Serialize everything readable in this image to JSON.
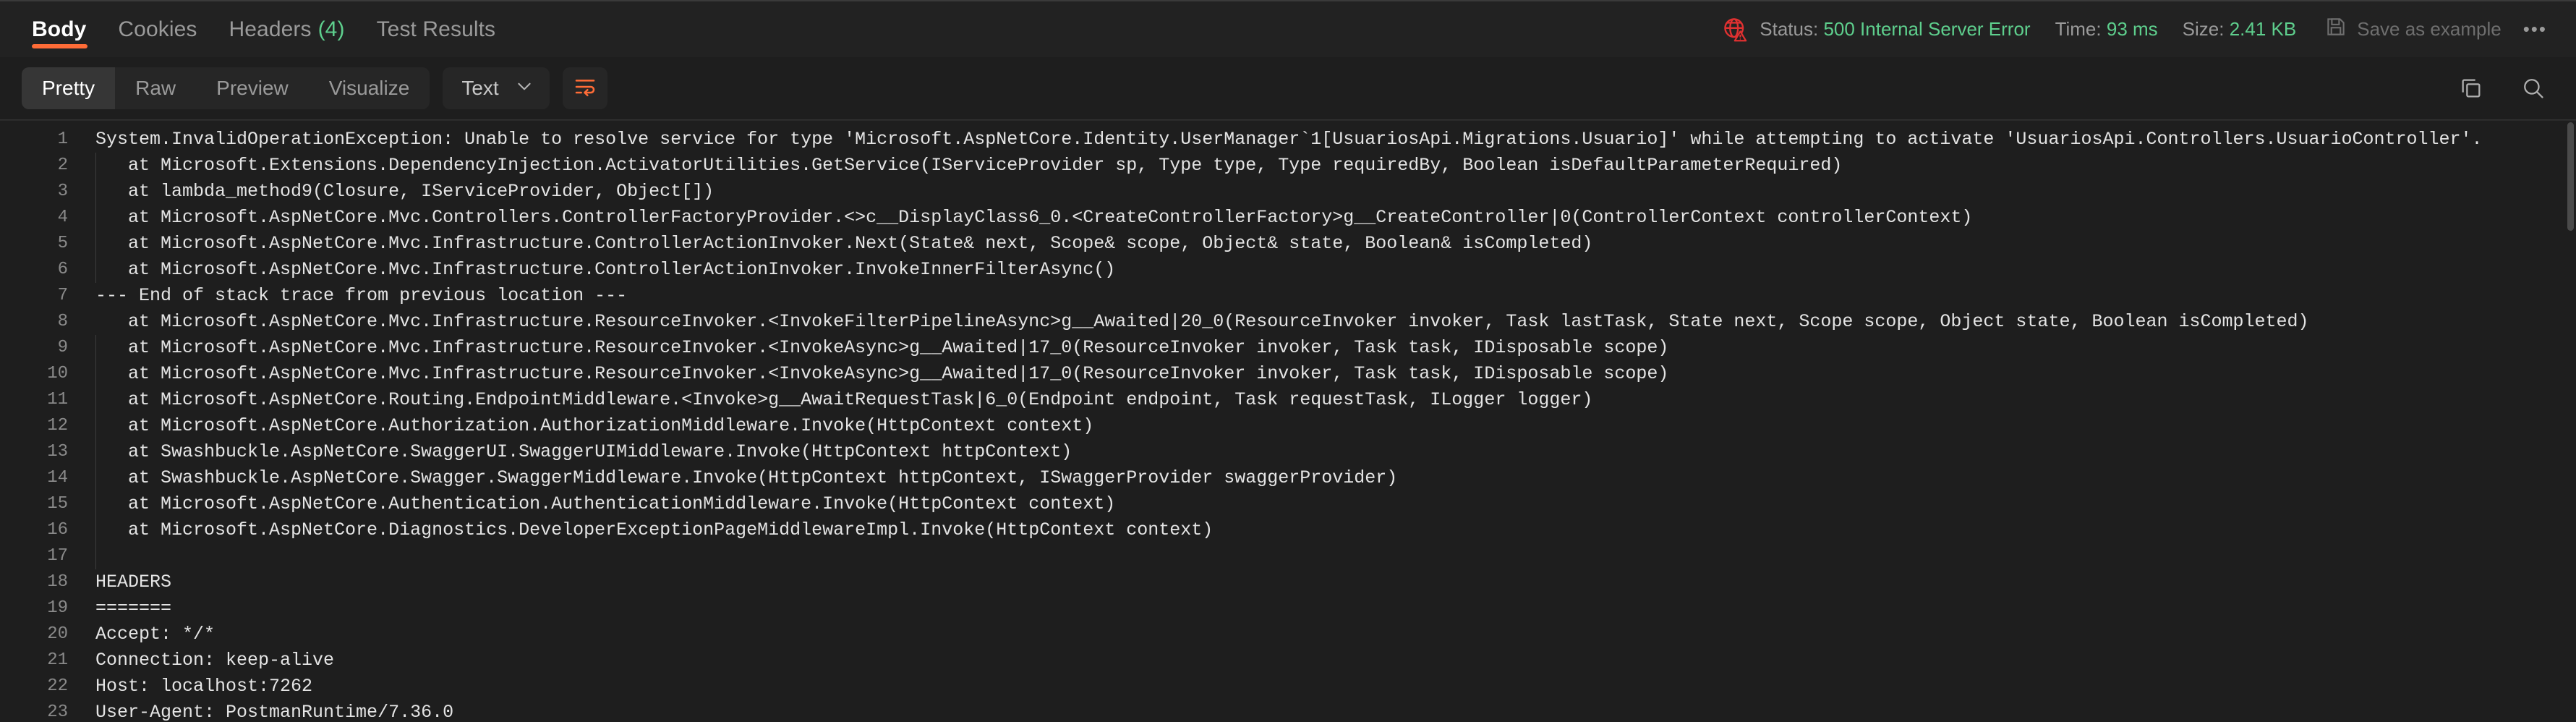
{
  "response_tabs": [
    {
      "label": "Body",
      "count": null,
      "active": true
    },
    {
      "label": "Cookies",
      "count": null,
      "active": false
    },
    {
      "label": "Headers",
      "count": "(4)",
      "active": false
    },
    {
      "label": "Test Results",
      "count": null,
      "active": false
    }
  ],
  "status_bar": {
    "status_icon": "globe-warning-icon",
    "status_label": "Status:",
    "status_value": "500 Internal Server Error",
    "time_label": "Time:",
    "time_value": "93 ms",
    "size_label": "Size:",
    "size_value": "2.41 KB",
    "save_icon": "floppy-disk-icon",
    "save_label": "Save as example",
    "more_label": "•••",
    "error_color": "#e03131",
    "ok_color": "#5ecf8d"
  },
  "toolbar": {
    "view_modes": [
      {
        "label": "Pretty",
        "active": true
      },
      {
        "label": "Raw",
        "active": false
      },
      {
        "label": "Preview",
        "active": false
      },
      {
        "label": "Visualize",
        "active": false
      }
    ],
    "format_select": {
      "value": "Text",
      "chevron": "chevron-down-icon"
    },
    "wrap_button": {
      "icon": "wrap-text-icon",
      "accent": "#ff6c37"
    },
    "copy_button": {
      "icon": "copy-icon"
    },
    "search_button": {
      "icon": "search-icon"
    }
  },
  "accent_color": "#ff6c37",
  "highlight_color": "#4b4a2f",
  "editor": {
    "lines": [
      {
        "n": 1,
        "text": "System.InvalidOperationException: Unable to resolve service for type 'Microsoft.AspNetCore.Identity.UserManager`1[UsuariosApi.Migrations.Usuario]' while attempting to activate 'UsuariosApi.Controllers.UsuarioController'.",
        "highlight": true
      },
      {
        "n": 2,
        "text": "   at Microsoft.Extensions.DependencyInjection.ActivatorUtilities.GetService(IServiceProvider sp, Type type, Type requiredBy, Boolean isDefaultParameterRequired)",
        "highlight": false
      },
      {
        "n": 3,
        "text": "   at lambda_method9(Closure, IServiceProvider, Object[])",
        "highlight": false
      },
      {
        "n": 4,
        "text": "   at Microsoft.AspNetCore.Mvc.Controllers.ControllerFactoryProvider.<>c__DisplayClass6_0.<CreateControllerFactory>g__CreateController|0(ControllerContext controllerContext)",
        "highlight": false
      },
      {
        "n": 5,
        "text": "   at Microsoft.AspNetCore.Mvc.Infrastructure.ControllerActionInvoker.Next(State& next, Scope& scope, Object& state, Boolean& isCompleted)",
        "highlight": false
      },
      {
        "n": 6,
        "text": "   at Microsoft.AspNetCore.Mvc.Infrastructure.ControllerActionInvoker.InvokeInnerFilterAsync()",
        "highlight": false
      },
      {
        "n": 7,
        "text": "--- End of stack trace from previous location ---",
        "highlight": false
      },
      {
        "n": 8,
        "text": "   at Microsoft.AspNetCore.Mvc.Infrastructure.ResourceInvoker.<InvokeFilterPipelineAsync>g__Awaited|20_0(ResourceInvoker invoker, Task lastTask, State next, Scope scope, Object state, Boolean isCompleted)",
        "highlight": false
      },
      {
        "n": 9,
        "text": "   at Microsoft.AspNetCore.Mvc.Infrastructure.ResourceInvoker.<InvokeAsync>g__Awaited|17_0(ResourceInvoker invoker, Task task, IDisposable scope)",
        "highlight": false
      },
      {
        "n": 10,
        "text": "   at Microsoft.AspNetCore.Mvc.Infrastructure.ResourceInvoker.<InvokeAsync>g__Awaited|17_0(ResourceInvoker invoker, Task task, IDisposable scope)",
        "highlight": false
      },
      {
        "n": 11,
        "text": "   at Microsoft.AspNetCore.Routing.EndpointMiddleware.<Invoke>g__AwaitRequestTask|6_0(Endpoint endpoint, Task requestTask, ILogger logger)",
        "highlight": false
      },
      {
        "n": 12,
        "text": "   at Microsoft.AspNetCore.Authorization.AuthorizationMiddleware.Invoke(HttpContext context)",
        "highlight": false
      },
      {
        "n": 13,
        "text": "   at Swashbuckle.AspNetCore.SwaggerUI.SwaggerUIMiddleware.Invoke(HttpContext httpContext)",
        "highlight": false
      },
      {
        "n": 14,
        "text": "   at Swashbuckle.AspNetCore.Swagger.SwaggerMiddleware.Invoke(HttpContext httpContext, ISwaggerProvider swaggerProvider)",
        "highlight": false
      },
      {
        "n": 15,
        "text": "   at Microsoft.AspNetCore.Authentication.AuthenticationMiddleware.Invoke(HttpContext context)",
        "highlight": false
      },
      {
        "n": 16,
        "text": "   at Microsoft.AspNetCore.Diagnostics.DeveloperExceptionPageMiddlewareImpl.Invoke(HttpContext context)",
        "highlight": false
      },
      {
        "n": 17,
        "text": "",
        "highlight": false
      },
      {
        "n": 18,
        "text": "HEADERS",
        "highlight": false
      },
      {
        "n": 19,
        "text": "=======",
        "highlight": false
      },
      {
        "n": 20,
        "text": "Accept: */*",
        "highlight": false
      },
      {
        "n": 21,
        "text": "Connection: keep-alive",
        "highlight": false
      },
      {
        "n": 22,
        "text": "Host: localhost:7262",
        "highlight": false
      },
      {
        "n": 23,
        "text": "User-Agent: PostmanRuntime/7.36.0",
        "highlight": false
      }
    ]
  }
}
